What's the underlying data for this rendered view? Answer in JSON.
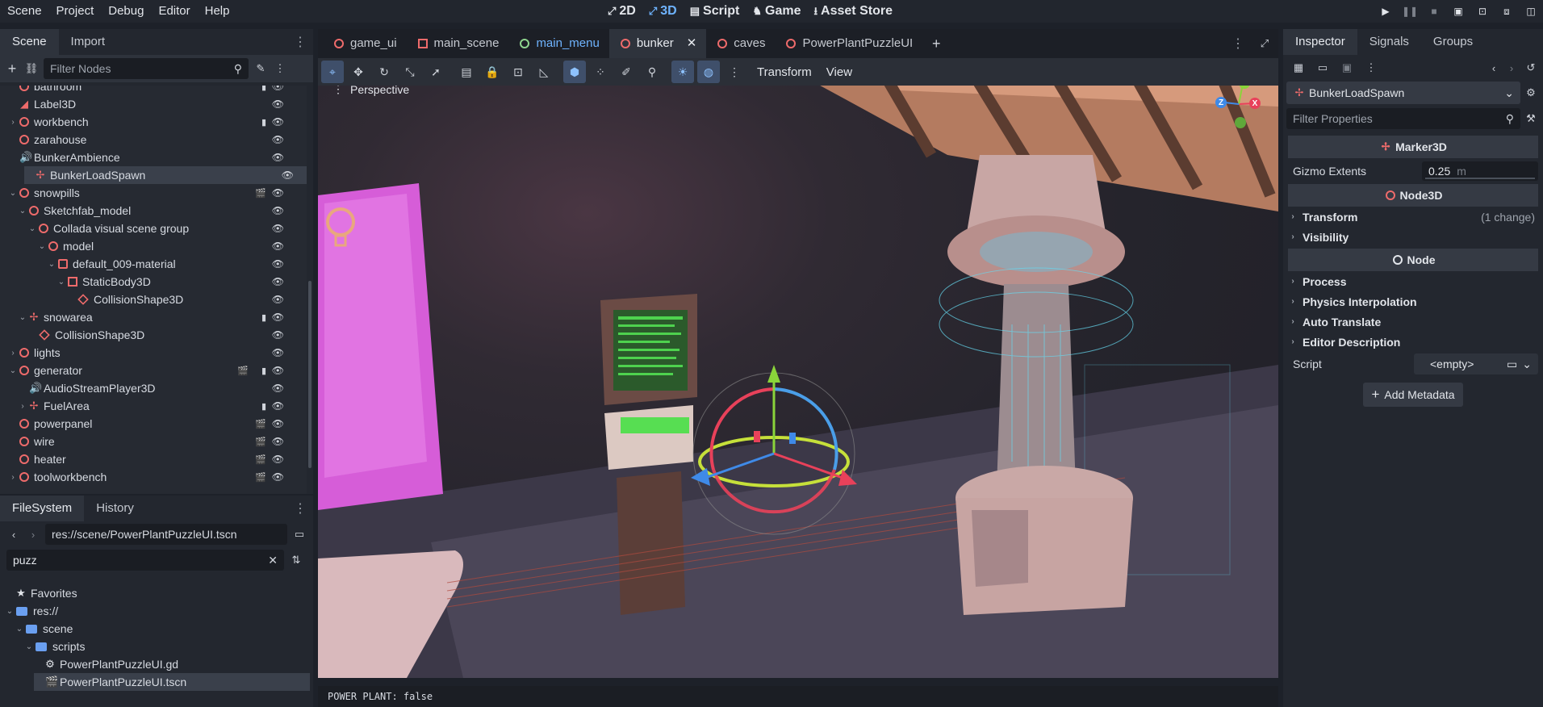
{
  "menu": [
    "Scene",
    "Project",
    "Debug",
    "Editor",
    "Help"
  ],
  "modes": [
    {
      "label": "2D",
      "glyph": "⌐",
      "active": false
    },
    {
      "label": "3D",
      "glyph": "⌐",
      "active": true
    },
    {
      "label": "Script",
      "glyph": "▮",
      "active": false
    },
    {
      "label": "Game",
      "glyph": "◆",
      "active": false
    },
    {
      "label": "Asset Store",
      "glyph": "⭳",
      "active": false
    }
  ],
  "scene_dock": {
    "tabs": [
      "Scene",
      "Import"
    ],
    "filter_placeholder": "Filter Nodes",
    "nodes": [
      {
        "label": "bathroom",
        "depth": 1,
        "icon": "ring",
        "chev": "none",
        "badge": "script"
      },
      {
        "label": "Label3D",
        "depth": 1,
        "icon": "label",
        "chev": "none",
        "badge": ""
      },
      {
        "label": "workbench",
        "depth": 1,
        "icon": "ring",
        "chev": "right",
        "badge": "script"
      },
      {
        "label": "zarahouse",
        "depth": 1,
        "icon": "ring",
        "chev": "none",
        "badge": ""
      },
      {
        "label": "BunkerAmbience",
        "depth": 1,
        "icon": "speaker",
        "chev": "none",
        "badge": ""
      },
      {
        "label": "BunkerLoadSpawn",
        "depth": 1,
        "icon": "marker",
        "chev": "none",
        "badge": "",
        "selected": true
      },
      {
        "label": "snowpills",
        "depth": 1,
        "icon": "ring",
        "chev": "down",
        "badge": "scene"
      },
      {
        "label": "Sketchfab_model",
        "depth": 2,
        "icon": "ring",
        "chev": "down",
        "badge": ""
      },
      {
        "label": "Collada visual scene group",
        "depth": 3,
        "icon": "ring",
        "chev": "down",
        "badge": ""
      },
      {
        "label": "model",
        "depth": 4,
        "icon": "ring",
        "chev": "down",
        "badge": ""
      },
      {
        "label": "default_009-material",
        "depth": 5,
        "icon": "square",
        "chev": "down",
        "badge": ""
      },
      {
        "label": "StaticBody3D",
        "depth": 6,
        "icon": "dashed",
        "chev": "down",
        "badge": ""
      },
      {
        "label": "CollisionShape3D",
        "depth": 7,
        "icon": "cube",
        "chev": "none",
        "badge": ""
      },
      {
        "label": "snowarea",
        "depth": 2,
        "icon": "marker",
        "chev": "down",
        "badge": "script"
      },
      {
        "label": "CollisionShape3D",
        "depth": 3,
        "icon": "cube",
        "chev": "none",
        "badge": ""
      },
      {
        "label": "lights",
        "depth": 1,
        "icon": "ring",
        "chev": "right",
        "badge": ""
      },
      {
        "label": "generator",
        "depth": 1,
        "icon": "ring",
        "chev": "down",
        "badge": "both"
      },
      {
        "label": "AudioStreamPlayer3D",
        "depth": 2,
        "icon": "speaker",
        "chev": "none",
        "badge": ""
      },
      {
        "label": "FuelArea",
        "depth": 2,
        "icon": "marker",
        "chev": "right",
        "badge": "script"
      },
      {
        "label": "powerpanel",
        "depth": 1,
        "icon": "ring",
        "chev": "none",
        "badge": "scene"
      },
      {
        "label": "wire",
        "depth": 1,
        "icon": "ring",
        "chev": "none",
        "badge": "scene"
      },
      {
        "label": "heater",
        "depth": 1,
        "icon": "ring",
        "chev": "none",
        "badge": "scene"
      },
      {
        "label": "toolworkbench",
        "depth": 1,
        "icon": "ring",
        "chev": "right",
        "badge": "scene"
      }
    ]
  },
  "filesystem": {
    "tabs": [
      "FileSystem",
      "History"
    ],
    "path": "res://scene/PowerPlantPuzzleUI.tscn",
    "search": "puzz",
    "items": [
      {
        "label": "Favorites",
        "depth": 0,
        "icon": "star",
        "chev": "none"
      },
      {
        "label": "res://",
        "depth": 0,
        "icon": "folder",
        "chev": "down"
      },
      {
        "label": "scene",
        "depth": 1,
        "icon": "folder",
        "chev": "down"
      },
      {
        "label": "scripts",
        "depth": 2,
        "icon": "folder",
        "chev": "down"
      },
      {
        "label": "PowerPlantPuzzleUI.gd",
        "depth": 3,
        "icon": "gear",
        "chev": "none"
      },
      {
        "label": "PowerPlantPuzzleUI.tscn",
        "depth": 2,
        "icon": "clap",
        "chev": "none",
        "selected": true
      }
    ]
  },
  "editor_tabs": [
    {
      "label": "game_ui",
      "icon": "ring",
      "active": false,
      "color": "#ee6b6b"
    },
    {
      "label": "main_scene",
      "icon": "dashed",
      "active": false,
      "color": "#ee6b6b"
    },
    {
      "label": "main_menu",
      "icon": "ring",
      "active": false,
      "color": "#8fd68f",
      "text_color": "#6fb4ff"
    },
    {
      "label": "bunker",
      "icon": "ring",
      "active": true,
      "color": "#ee6b6b"
    },
    {
      "label": "caves",
      "icon": "ring",
      "active": false,
      "color": "#ee6b6b"
    },
    {
      "label": "PowerPlantPuzzleUI",
      "icon": "ring",
      "active": false,
      "color": "#ee6b6b"
    }
  ],
  "viewport_toolbar": {
    "transform": "Transform",
    "view": "View"
  },
  "viewport_label": "Perspective",
  "axis": {
    "x": "X",
    "y": "Y",
    "z": "Z",
    "x_color": "#e8415a",
    "y_color": "#8ad43a",
    "z_color": "#3f8ae8"
  },
  "status_text": "POWER PLANT: false",
  "inspector": {
    "tabs": [
      "Inspector",
      "Signals",
      "Groups"
    ],
    "node_name": "BunkerLoadSpawn",
    "filter_placeholder": "Filter Properties",
    "sections": {
      "marker": "Marker3D",
      "node3d": "Node3D",
      "node": "Node"
    },
    "gizmo_label": "Gizmo Extents",
    "gizmo_value": "0.25",
    "gizmo_unit": "m",
    "transform_label": "Transform",
    "transform_note": "(1 change)",
    "visibility_label": "Visibility",
    "node_props": [
      "Process",
      "Physics Interpolation",
      "Auto Translate",
      "Editor Description"
    ],
    "script_label": "Script",
    "script_value": "<empty>",
    "add_metadata": "Add Metadata"
  }
}
